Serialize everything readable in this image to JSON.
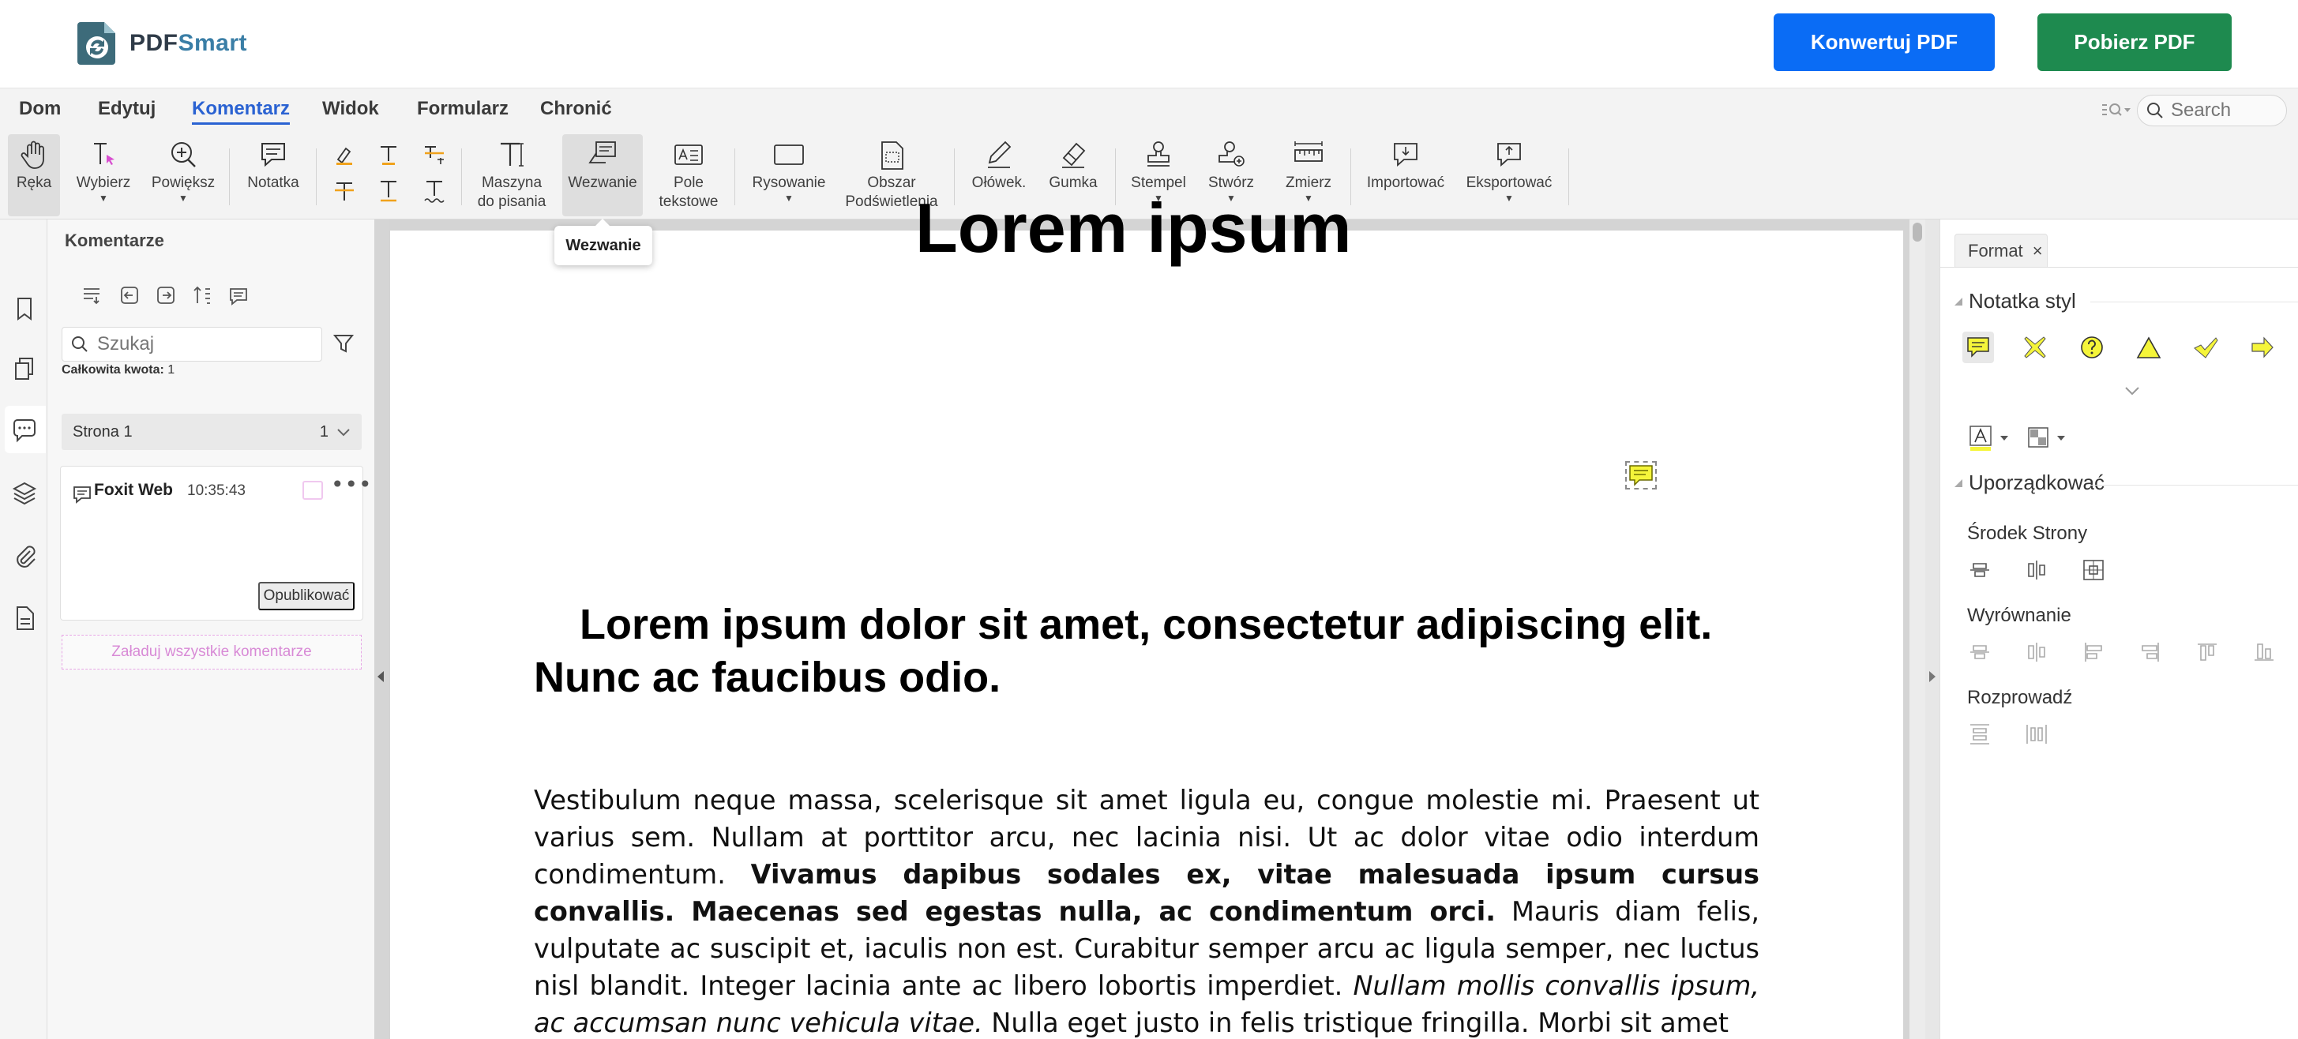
{
  "header": {
    "logo_text_a": "PDF",
    "logo_text_b": "Smart",
    "convert_label": "Konwertuj PDF",
    "download_label": "Pobierz PDF",
    "convert_color": "#0a6cf5",
    "download_color": "#1e8a4f"
  },
  "menu": {
    "tabs": [
      "Dom",
      "Edytuj",
      "Komentarz",
      "Widok",
      "Formularz",
      "Chronić"
    ],
    "active": "Komentarz",
    "search_placeholder": "Search"
  },
  "toolbar": {
    "tools": [
      {
        "label": "Ręka",
        "icon": "hand-icon",
        "active": true
      },
      {
        "label": "Wybierz",
        "icon": "select-cursor-icon",
        "caret": true
      },
      {
        "label": "Powiększ",
        "icon": "zoom-icon",
        "caret": true
      },
      {
        "label": "Notatka",
        "icon": "note-icon"
      },
      {
        "label": "Maszyna\ndo pisania",
        "icon": "typewriter-icon"
      },
      {
        "label": "Wezwanie",
        "icon": "callout-icon",
        "active": true
      },
      {
        "label": "Pole\ntekstowe",
        "icon": "textbox-icon"
      },
      {
        "label": "Rysowanie",
        "icon": "rectangle-icon",
        "caret": true
      },
      {
        "label": "Obszar\nPodświetlenia",
        "icon": "area-highlight-icon"
      },
      {
        "label": "Ołówek.",
        "icon": "pencil-icon"
      },
      {
        "label": "Gumka",
        "icon": "eraser-icon"
      },
      {
        "label": "Stempel",
        "icon": "stamp-icon",
        "caret": true
      },
      {
        "label": "Stwórz",
        "icon": "create-stamp-icon",
        "caret": true
      },
      {
        "label": "Zmierz",
        "icon": "ruler-icon",
        "caret": true
      },
      {
        "label": "Importować",
        "icon": "import-icon"
      },
      {
        "label": "Eksportować",
        "icon": "export-icon",
        "caret": true
      }
    ],
    "tooltip": "Wezwanie"
  },
  "comments_panel": {
    "title": "Komentarze",
    "search_placeholder": "Szukaj",
    "total_label": "Całkowita kwota:",
    "total_value": "1",
    "page_group_label": "Strona 1",
    "page_group_count": "1",
    "comment": {
      "author": "Foxit Web",
      "time": "10:35:43",
      "publish_label": "Opublikować",
      "swatch_color": "#f0c8ef"
    },
    "load_all_label": "Załaduj wszystkie komentarze"
  },
  "document": {
    "title": "Lorem ipsum",
    "heading": "Lorem ipsum dolor sit amet, consectetur adipiscing elit. Nunc ac faucibus odio.",
    "para_a": "Vestibulum neque massa, scelerisque sit amet ligula eu, congue molestie mi. Praesent ut varius sem. Nullam at porttitor arcu, nec lacinia nisi. Ut ac dolor vitae odio interdum condimentum. ",
    "para_b": "Vivamus dapibus sodales ex, vitae malesuada ipsum cursus convallis. Maecenas sed egestas nulla, ac condimentum orci.",
    "para_c": " Mauris diam felis, vulputate ac suscipit et, iaculis non est. Curabitur semper arcu ac ligula semper, nec luctus nisl blandit. Integer lacinia ante ac libero lobortis imperdiet. ",
    "para_d": "Nullam mollis convallis ipsum, ac accumsan nunc vehicula vitae.",
    "para_e": " Nulla eget justo in felis tristique fringilla. Morbi sit amet"
  },
  "format_panel": {
    "tab_label": "Format",
    "note_style_title": "Notatka styl",
    "arrange_title": "Uporządkować",
    "page_center_label": "Środek Strony",
    "align_label": "Wyrównanie",
    "distribute_label": "Rozprowadź",
    "note_yellow": "#f5f53a"
  }
}
